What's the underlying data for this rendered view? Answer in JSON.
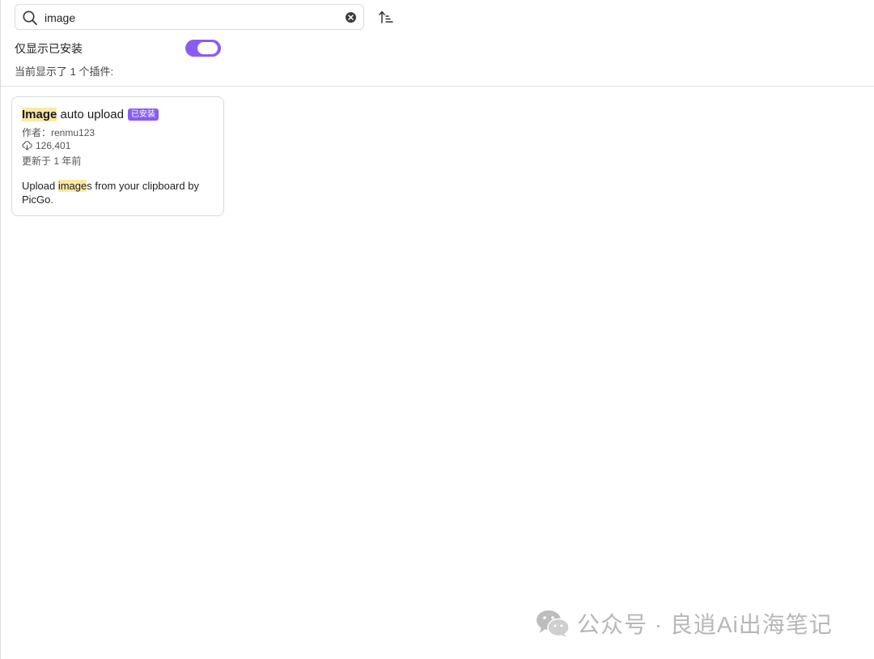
{
  "search": {
    "value": "image"
  },
  "filter": {
    "installed_only_label": "仅显示已安装",
    "installed_only_on": true
  },
  "result_count_text": "当前显示了 1 个插件:",
  "plugins": [
    {
      "title_highlight": "Image",
      "title_rest": " auto upload",
      "badge": "已安装",
      "author": "作者：renmu123",
      "downloads": "126,401",
      "updated": "更新于 1 年前",
      "desc_before": "Upload ",
      "desc_highlight": "image",
      "desc_after": "s from your clipboard by PicGo."
    }
  ],
  "watermark": {
    "text": "公众号 · 良逍Ai出海笔记",
    "logo": "wechat-logo"
  },
  "colors": {
    "accent": "#8a5cf6",
    "highlight": "#fbe8a6"
  },
  "icons": {
    "search": "search-icon",
    "clear": "clear-icon",
    "sort": "sort-icon",
    "downloads": "download-cloud-icon"
  }
}
